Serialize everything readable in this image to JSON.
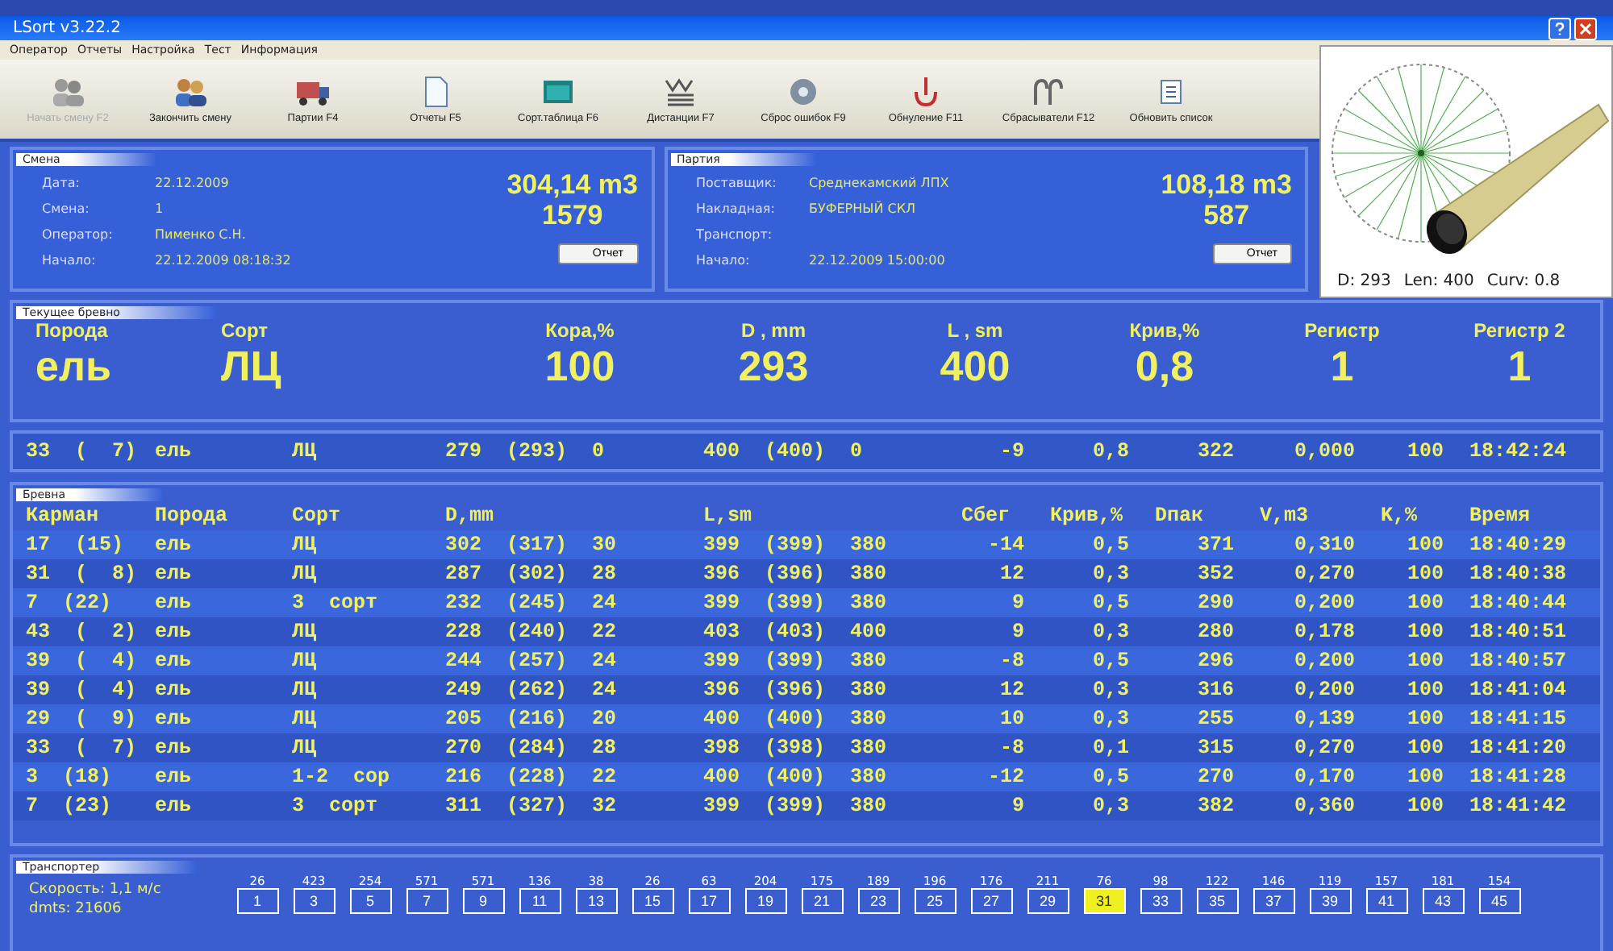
{
  "window": {
    "title": "LSort v3.22.2"
  },
  "menu": [
    "Оператор",
    "Отчеты",
    "Настройка",
    "Тест",
    "Информация"
  ],
  "toolbar": [
    {
      "label": "Начать смену F2",
      "disabled": true
    },
    {
      "label": "Закончить смену",
      "disabled": false
    },
    {
      "label": "Партии F4",
      "disabled": false
    },
    {
      "label": "Отчеты F5",
      "disabled": false
    },
    {
      "label": "Сорт.таблица F6",
      "disabled": false
    },
    {
      "label": "Дистанции F7",
      "disabled": false
    },
    {
      "label": "Сброс ошибок F9",
      "disabled": false
    },
    {
      "label": "Обнуление F11",
      "disabled": false
    },
    {
      "label": "Сбрасыватели F12",
      "disabled": false
    },
    {
      "label": "Обновить список",
      "disabled": false
    }
  ],
  "panels": [
    {
      "title": "Смена",
      "fields": [
        {
          "label": "Дата:",
          "value": "22.12.2009"
        },
        {
          "label": "Смена:",
          "value": "1"
        },
        {
          "label": "Оператор:",
          "value": "Пименко С.Н."
        },
        {
          "label": "Начало:",
          "value": "22.12.2009 08:18:32"
        }
      ],
      "volume": "304,14 m3",
      "count": "1579",
      "button": "Отчет"
    },
    {
      "title": "Партия",
      "fields": [
        {
          "label": "Поставщик:",
          "value": "Среднекамский ЛПХ"
        },
        {
          "label": "Накладная:",
          "value": "БУФЕРНЫЙ СКЛ"
        },
        {
          "label": "Транспорт:"
        },
        {
          "label": "Начало:",
          "value": "22.12.2009 15:00:00"
        }
      ],
      "volume": "108,18 m3",
      "count": "587",
      "button": "Отчет"
    }
  ],
  "current": {
    "title": "Текущее бревно",
    "fields": [
      {
        "label": "Порода",
        "value": "ель"
      },
      {
        "label": "Сорт",
        "value": "ЛЦ"
      },
      {
        "label": "Кора,%",
        "value": "100"
      },
      {
        "label": "D , mm",
        "value": "293"
      },
      {
        "label": "L , sm",
        "value": "400"
      },
      {
        "label": "Крив,%",
        "value": "0,8"
      },
      {
        "label": "Регистр",
        "value": "1"
      },
      {
        "label": "Регистр 2",
        "value": "1"
      }
    ]
  },
  "last_row": [
    "33 ( 7)",
    "ель",
    "ЛЦ",
    "279 (293) 0",
    "400 (400) 0",
    "-9",
    "0,8",
    "322",
    "0,000",
    "100",
    "18:42:24"
  ],
  "logs": {
    "title": "Бревна",
    "columns": [
      "Карман",
      "Порода",
      "Сорт",
      "D,mm",
      "L,sm",
      "Сбег",
      "Крив,%",
      "Dпак",
      "V,m3",
      "K,%",
      "Время"
    ],
    "rows": [
      [
        "17 (15)",
        "ель",
        "ЛЦ",
        "302 (317) 30",
        "399 (399) 380",
        "-14",
        "0,5",
        "371",
        "0,310",
        "100",
        "18:40:29"
      ],
      [
        "31 ( 8)",
        "ель",
        "ЛЦ",
        "287 (302) 28",
        "396 (396) 380",
        "12",
        "0,3",
        "352",
        "0,270",
        "100",
        "18:40:38"
      ],
      [
        "7 (22)",
        "ель",
        "3 сорт",
        "232 (245) 24",
        "399 (399) 380",
        "9",
        "0,5",
        "290",
        "0,200",
        "100",
        "18:40:44"
      ],
      [
        "43 ( 2)",
        "ель",
        "ЛЦ",
        "228 (240) 22",
        "403 (403) 400",
        "9",
        "0,3",
        "280",
        "0,178",
        "100",
        "18:40:51"
      ],
      [
        "39 ( 4)",
        "ель",
        "ЛЦ",
        "244 (257) 24",
        "399 (399) 380",
        "-8",
        "0,5",
        "296",
        "0,200",
        "100",
        "18:40:57"
      ],
      [
        "39 ( 4)",
        "ель",
        "ЛЦ",
        "249 (262) 24",
        "396 (396) 380",
        "12",
        "0,3",
        "316",
        "0,200",
        "100",
        "18:41:04"
      ],
      [
        "29 ( 9)",
        "ель",
        "ЛЦ",
        "205 (216) 20",
        "400 (400) 380",
        "10",
        "0,3",
        "255",
        "0,139",
        "100",
        "18:41:15"
      ],
      [
        "33 ( 7)",
        "ель",
        "ЛЦ",
        "270 (284) 28",
        "398 (398) 380",
        "-8",
        "0,1",
        "315",
        "0,270",
        "100",
        "18:41:20"
      ],
      [
        "3 (18)",
        "ель",
        "1-2 сор",
        "216 (228) 22",
        "400 (400) 380",
        "-12",
        "0,5",
        "270",
        "0,170",
        "100",
        "18:41:28"
      ],
      [
        "7 (23)",
        "ель",
        "3 сорт",
        "311 (327) 32",
        "399 (399) 380",
        "9",
        "0,3",
        "382",
        "0,360",
        "100",
        "18:41:42"
      ]
    ]
  },
  "transport": {
    "title": "Транспортер",
    "speed": "Скорость: 1,1 м/с",
    "dmts": "dmts: 21606",
    "pockets": [
      {
        "count": "26",
        "number": "1",
        "selected": false
      },
      {
        "count": "423",
        "number": "3",
        "selected": false
      },
      {
        "count": "254",
        "number": "5",
        "selected": false
      },
      {
        "count": "571",
        "number": "7",
        "selected": false
      },
      {
        "count": "571",
        "number": "9",
        "selected": false
      },
      {
        "count": "136",
        "number": "11",
        "selected": false
      },
      {
        "count": "38",
        "number": "13",
        "selected": false
      },
      {
        "count": "26",
        "number": "15",
        "selected": false
      },
      {
        "count": "63",
        "number": "17",
        "selected": false
      },
      {
        "count": "204",
        "number": "19",
        "selected": false
      },
      {
        "count": "175",
        "number": "21",
        "selected": false
      },
      {
        "count": "189",
        "number": "23",
        "selected": false
      },
      {
        "count": "196",
        "number": "25",
        "selected": false
      },
      {
        "count": "176",
        "number": "27",
        "selected": false
      },
      {
        "count": "211",
        "number": "29",
        "selected": false
      },
      {
        "count": "76",
        "number": "31",
        "selected": true
      },
      {
        "count": "98",
        "number": "33",
        "selected": false
      },
      {
        "count": "122",
        "number": "35",
        "selected": false
      },
      {
        "count": "146",
        "number": "37",
        "selected": false
      },
      {
        "count": "119",
        "number": "39",
        "selected": false
      },
      {
        "count": "157",
        "number": "41",
        "selected": false
      },
      {
        "count": "181",
        "number": "43",
        "selected": false
      },
      {
        "count": "154",
        "number": "45",
        "selected": false
      }
    ]
  },
  "viewer": {
    "caption": [
      "D: 293",
      "Len: 400",
      "Curv: 0.8"
    ]
  }
}
